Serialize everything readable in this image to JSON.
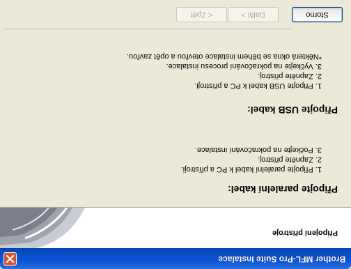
{
  "window": {
    "title": "Brother MFL-Pro Suite Instalace"
  },
  "header": {
    "title": "Připojení přístroje"
  },
  "parallel": {
    "heading": "Připojte paralelní kabel:",
    "steps": [
      "1. Připojte paralelní kabel k PC a přístroji.",
      "2. Zapněte přístroj.",
      "3. Počkejte na pokračování instalace."
    ]
  },
  "usb": {
    "heading": "Připojte USB kabel:",
    "steps": [
      "1. Připojte USB kabel k PC a přístroji.",
      "2. Zapněte přístroj.",
      "3. Vyčkejte na pokračování procesu instalace.",
      "*Některá okna se během instalace otevřou a opět zavřou."
    ]
  },
  "buttons": {
    "back": "< Zpět",
    "next": "Další >",
    "cancel": "Storno"
  },
  "colors": {
    "titlebar": "#0a54d8",
    "close_button": "#d9532f",
    "dialog_background": "#ece9d8"
  },
  "icons": {
    "close": "close-icon",
    "logo": "swoosh-logo"
  }
}
